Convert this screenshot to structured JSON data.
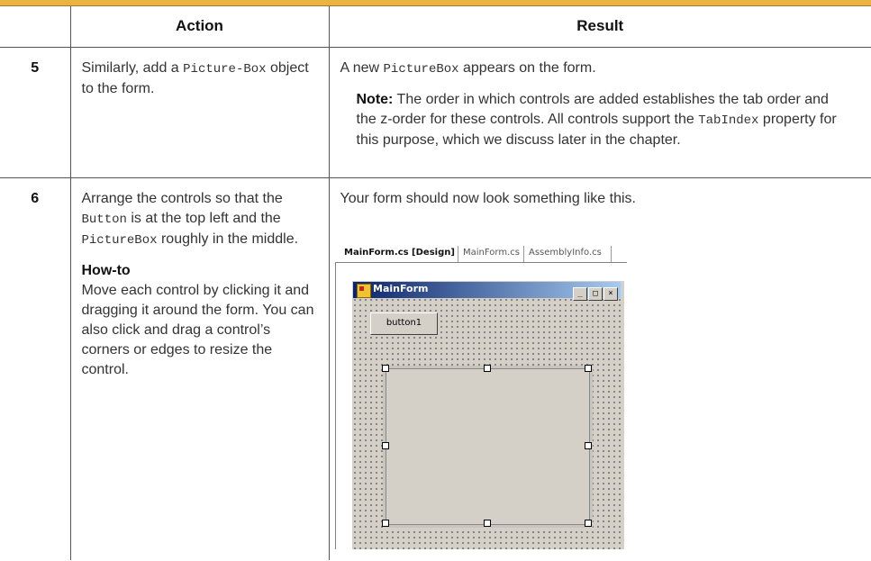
{
  "table": {
    "headers": {
      "number": "",
      "action": "Action",
      "result": "Result"
    }
  },
  "step5": {
    "number": "5",
    "action": {
      "prefix": "Similarly, add a ",
      "code": "Picture-Box",
      "suffix": " object to the form."
    },
    "result": {
      "prefix": "A new ",
      "code": "PictureBox",
      "suffix": " appears on the form."
    },
    "note": {
      "label": "Note:",
      "text_before": " The order in which controls are added establishes the tab order and the z-order for these controls. All controls support the ",
      "code": "TabIndex",
      "text_after": " property for this purpose, which we discuss later in the chapter."
    }
  },
  "step6": {
    "number": "6",
    "action": {
      "t1": "Arrange the controls so that the ",
      "code1": "Button",
      "t2": " is at the top left and the ",
      "code2": "PictureBox",
      "t3": " roughly in the middle."
    },
    "howto": {
      "title": "How-to",
      "text": "Move each control by clicking it and dragging it around the form. You can also click and drag a control’s corners or edges to resize the control."
    },
    "result": "Your form should now look something like this."
  },
  "figure": {
    "tabs": [
      "MainForm.cs [Design]",
      "MainForm.cs",
      "AssemblyInfo.cs"
    ],
    "window_title": "MainForm",
    "window_buttons": [
      "_",
      "□",
      "×"
    ],
    "button_label": "button1",
    "icons": [
      "form-icon",
      "minimize-icon",
      "maximize-icon",
      "close-icon"
    ]
  }
}
